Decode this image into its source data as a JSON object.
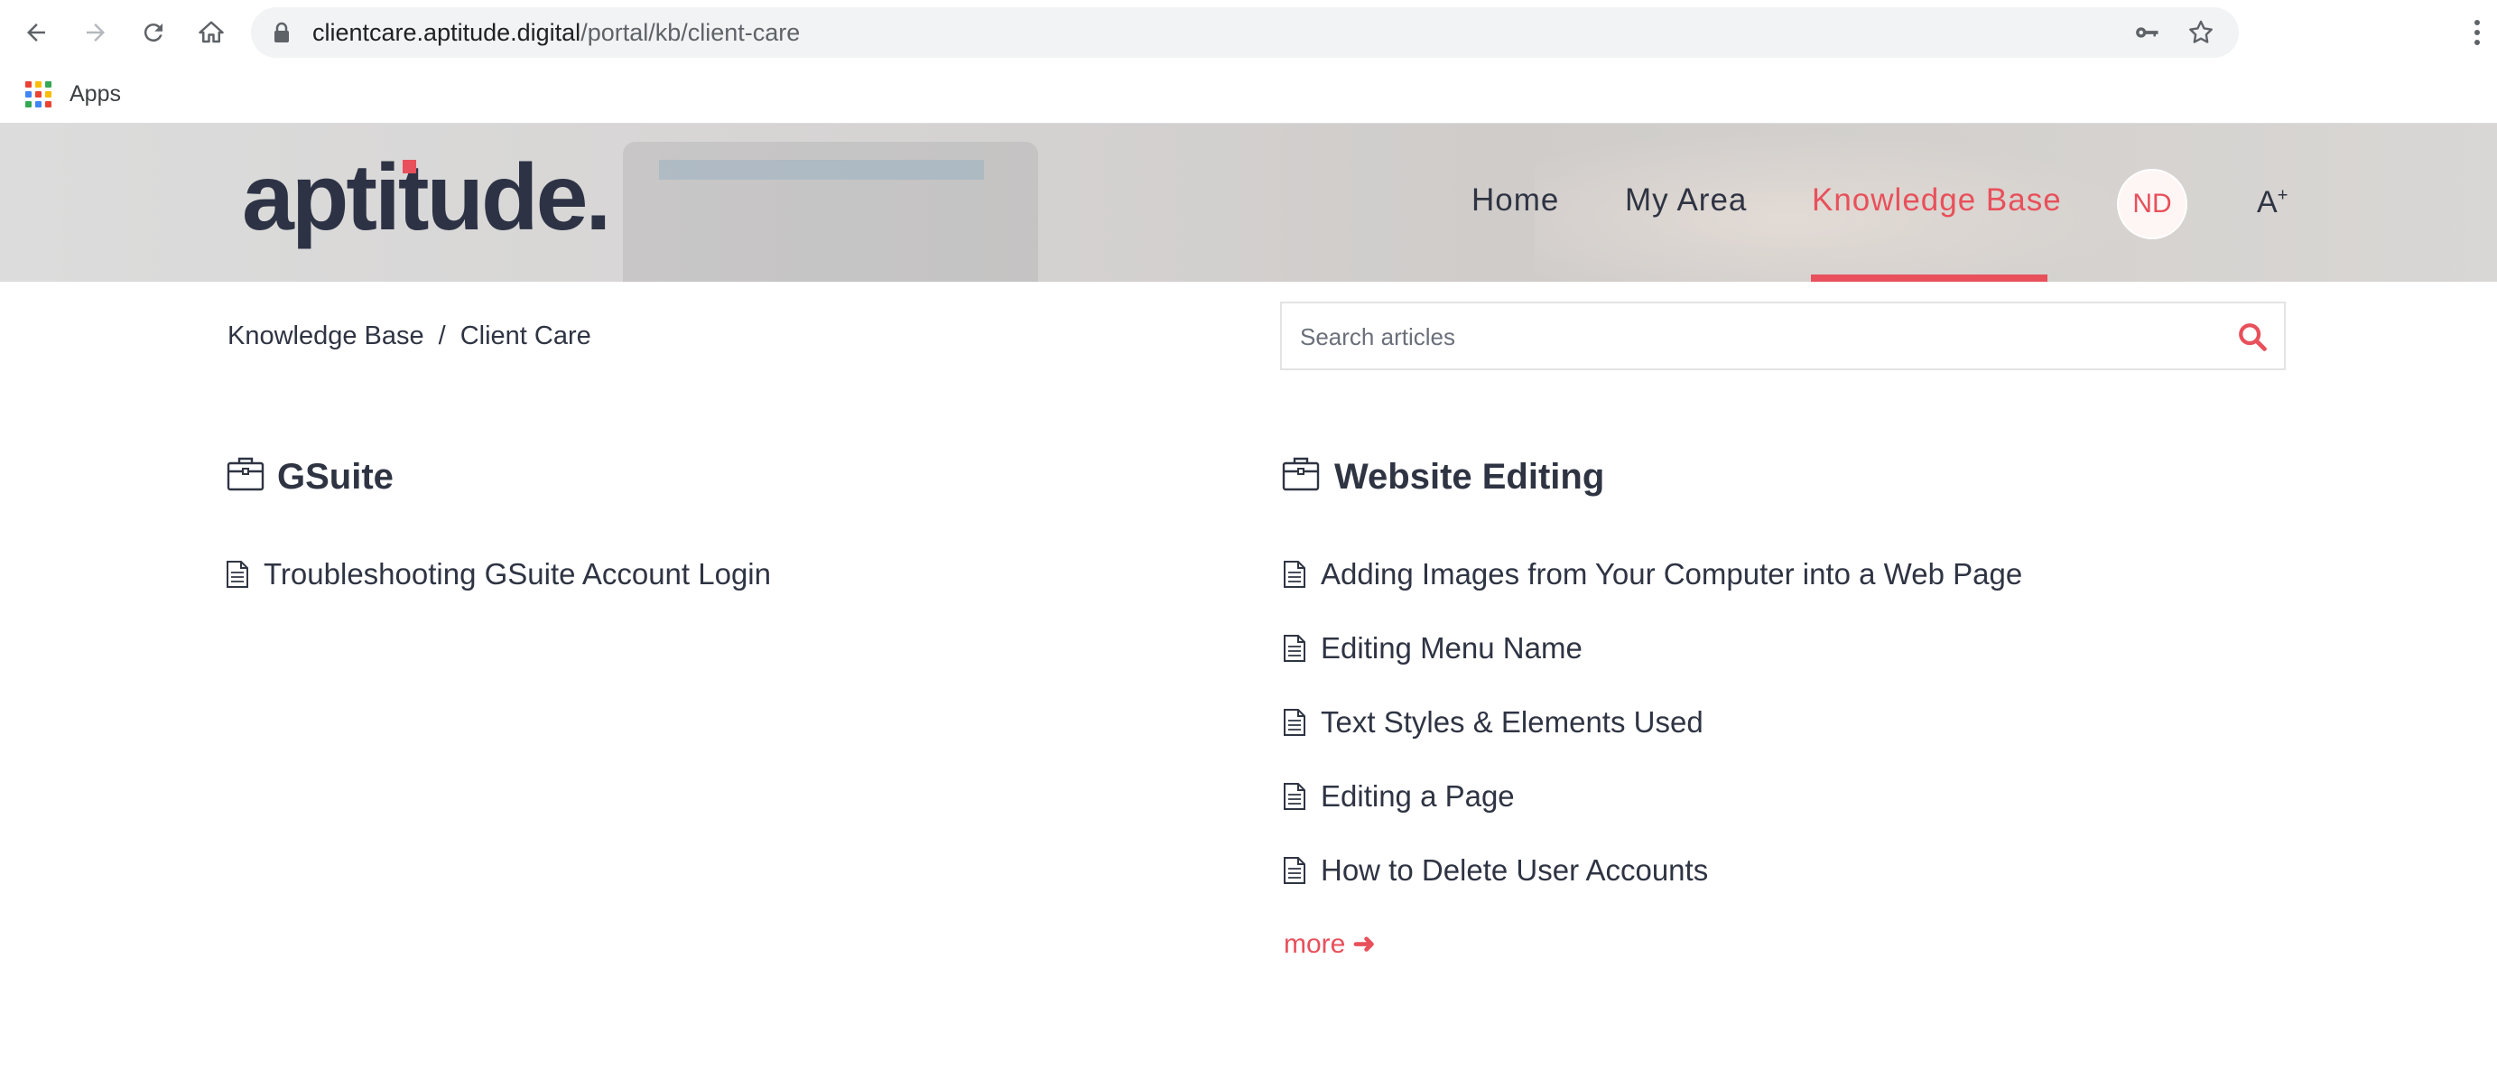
{
  "browser": {
    "url_host": "clientcare.aptitude.digital",
    "url_path": "/portal/kb/client-care",
    "bookmarks": {
      "apps_label": "Apps"
    }
  },
  "header": {
    "logo_text": "aptitude.",
    "nav": [
      {
        "label": "Home"
      },
      {
        "label": "My Area"
      },
      {
        "label": "Knowledge Base",
        "active": true
      }
    ],
    "avatar_initials": "ND",
    "font_toggle": "A",
    "font_toggle_sup": "+"
  },
  "breadcrumb": {
    "items": [
      "Knowledge Base",
      "Client Care"
    ],
    "separator": "/"
  },
  "search": {
    "placeholder": "Search articles",
    "value": ""
  },
  "sections": [
    {
      "title": "GSuite",
      "articles": [
        "Troubleshooting GSuite Account Login"
      ]
    },
    {
      "title": "Website Editing",
      "articles": [
        "Adding Images from Your Computer into a Web Page",
        "Editing Menu Name",
        "Text Styles & Elements Used",
        "Editing a Page",
        "How to Delete User Accounts"
      ],
      "more_label": "more",
      "more_arrow": "➜"
    }
  ],
  "colors": {
    "accent": "#e8505b",
    "text": "#2f3443"
  },
  "icons": {
    "browser": [
      "back-arrow-icon",
      "forward-arrow-icon",
      "reload-icon",
      "home-icon",
      "lock-icon",
      "key-icon",
      "star-icon",
      "kebab-menu-icon",
      "apps-grid-icon"
    ],
    "page": [
      "briefcase-icon",
      "document-icon",
      "search-icon",
      "arrow-right-icon"
    ]
  }
}
